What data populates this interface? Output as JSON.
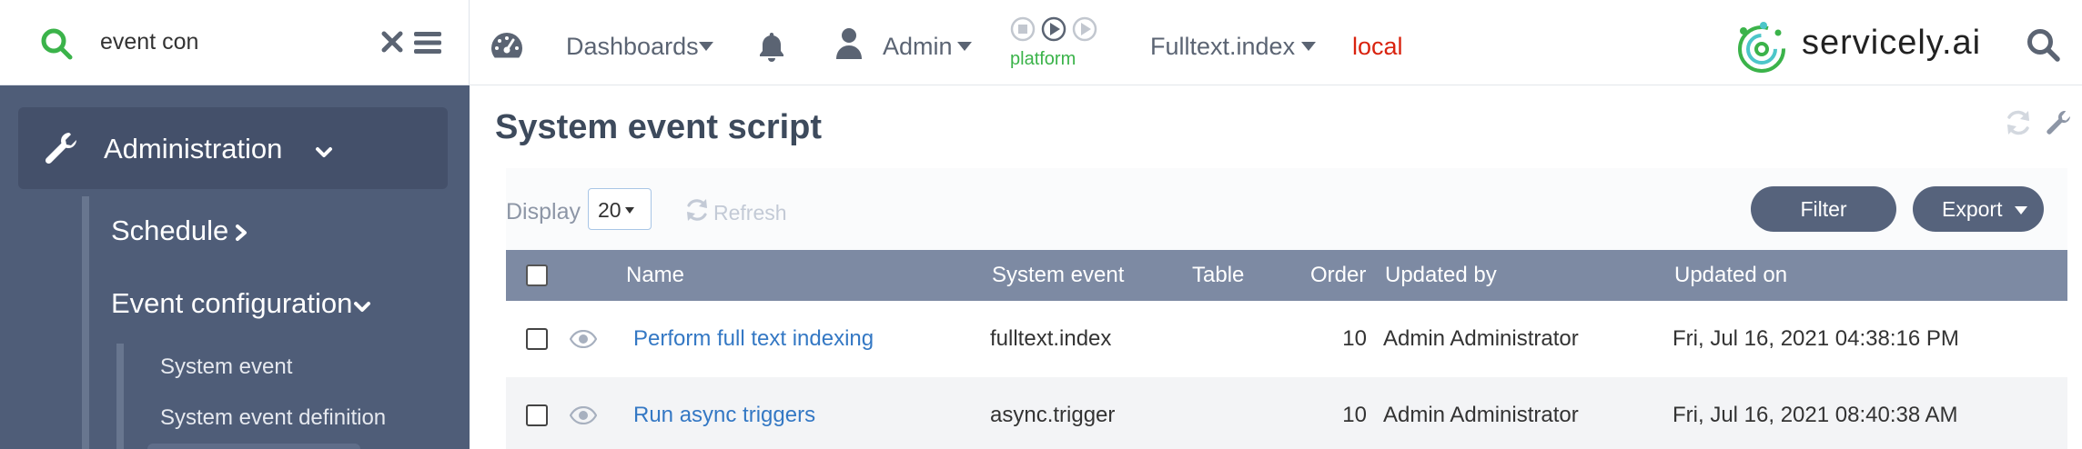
{
  "sidebar": {
    "search": {
      "value": "event con"
    },
    "items": [
      {
        "label": "Administration"
      },
      {
        "label": "Schedule"
      },
      {
        "label": "Event configuration"
      },
      {
        "label": "System event"
      },
      {
        "label": "System event definition"
      }
    ]
  },
  "topbar": {
    "dashboards": "Dashboards",
    "user": "Admin",
    "platform": "platform",
    "app": "Fulltext.index",
    "env": "local",
    "brand": "servicely.ai"
  },
  "main": {
    "title": "System event script",
    "toolbar": {
      "display_label": "Display",
      "display_value": "20",
      "refresh_label": "Refresh",
      "filter_label": "Filter",
      "export_label": "Export"
    },
    "table": {
      "columns": [
        "Name",
        "System event",
        "Table",
        "Order",
        "Updated by",
        "Updated on"
      ],
      "rows": [
        {
          "name": "Perform full text indexing",
          "event": "fulltext.index",
          "table": "",
          "order": "10",
          "updated_by": "Admin Administrator",
          "updated_on": "Fri, Jul 16, 2021 04:38:16 PM"
        },
        {
          "name": "Run async triggers",
          "event": "async.trigger",
          "table": "",
          "order": "10",
          "updated_by": "Admin Administrator",
          "updated_on": "Fri, Jul 16, 2021 08:40:38 AM"
        }
      ]
    }
  },
  "colors": {
    "sidebar_bg": "#4f5d78",
    "header_bg": "#7d8aa3",
    "link": "#3478c4",
    "env_red": "#d9230f",
    "platform_green": "#3bb34a"
  }
}
